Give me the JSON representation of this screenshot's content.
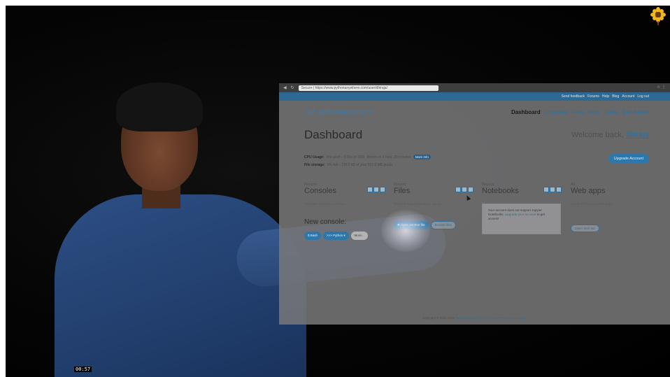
{
  "video": {
    "timestamp": "00:57"
  },
  "browser": {
    "url": "Secure | https://www.pythonanywhere.com/user/dhiraja/",
    "top_links": [
      "Send feedback",
      "Forums",
      "Help",
      "Blog",
      "Account",
      "Log out"
    ],
    "brand": "pythonanywhere",
    "nav": [
      {
        "label": "Dashboard",
        "active": true
      },
      {
        "label": "Consoles",
        "active": false
      },
      {
        "label": "Files",
        "active": false
      },
      {
        "label": "Web",
        "active": false
      },
      {
        "label": "Tasks",
        "active": false
      },
      {
        "label": "Databases",
        "active": false
      }
    ],
    "page_title": "Dashboard",
    "welcome_prefix": "Welcome back,",
    "username": "dhiraja",
    "cpu_label": "CPU Usage:",
    "cpu_text": "0% used – 0.00s of 100s. Resets in 1 hour, 23 minutes",
    "more_info": "More Info",
    "file_label": "File storage:",
    "file_text": "0% full – 110.0 kB of your 512.0 MB quota",
    "upgrade": "Upgrade Account",
    "sections": {
      "consoles": {
        "kicker": "Recent",
        "name": "Consoles",
        "note": "You have no recent consoles."
      },
      "files": {
        "kicker": "Recent",
        "name": "Files",
        "note": "/home/dhiraja/mysite/flask_app.py"
      },
      "notebooks": {
        "kicker": "Recent",
        "name": "Notebooks"
      },
      "webapps": {
        "kicker": "All",
        "name": "Web apps",
        "note": "You don't have any web apps."
      }
    },
    "new_console_label": "New console:",
    "console_buttons": [
      "$ Bash",
      ">>> Python ▾",
      "More..."
    ],
    "files_buttons": [
      "Open another file",
      "Browse files"
    ],
    "notebook_msg_1": "Your account does not support Jupyter Notebooks.",
    "notebook_link": "Upgrade your account",
    "notebook_msg_2": "to get access!",
    "webapp_button": "Open Web tab",
    "footer_prefix": "Copyright © 2011-2018",
    "footer_company": "PythonAnywhere LLP",
    "footer_terms": "Terms",
    "footer_privacy": "Privacy & Cookies"
  },
  "colors": {
    "accent": "#2e77aa",
    "brand": "#3d7aa6"
  }
}
